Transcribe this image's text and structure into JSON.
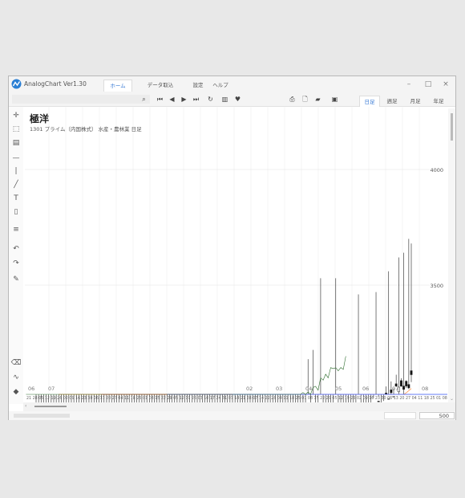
{
  "app": {
    "title": "AnalogChart Ver1.30"
  },
  "tabs": [
    {
      "label": "ホーム",
      "active": true
    },
    {
      "label": "データ取込",
      "active": false
    },
    {
      "label": "設定",
      "active": false
    },
    {
      "label": "ヘルプ",
      "active": false
    }
  ],
  "periods": [
    {
      "label": "日足",
      "active": true
    },
    {
      "label": "週足",
      "active": false
    },
    {
      "label": "月足",
      "active": false
    },
    {
      "label": "年足",
      "active": false
    }
  ],
  "stock": {
    "name": "極洋",
    "info": "1301 プライム（内国株式） 水産・農林業 日足"
  },
  "zoom": {
    "value": "500"
  },
  "chart_data": {
    "type": "candlestick",
    "y_ticks": [
      "4000",
      "3500"
    ],
    "month_labels": [
      "06",
      "07",
      "02",
      "03",
      "04",
      "05",
      "06",
      "07",
      "08"
    ],
    "date_ticks": "21 28 05 12 19 26 02 09 16 23 30 06 13 20 27 04 11 18 25 01 08 15 22 29 05 12 19 26 03 10 17 24 31 07 14 21 28 07 14 22 28 04 11 18 25 01 08 15 22 29 05 12 19 26 02 09 16 23 30 06 13 20 27 04 11 18 25 01 08 15 22 29",
    "line_colors": {
      "kijun": "#e83030",
      "tenkan": "#ff8a3c",
      "spanA": "#4040d0",
      "spanB": "#6080ff",
      "chikou": "#2a6a2a"
    },
    "candle_colors": {
      "up": "#ffffff",
      "down": "#111111"
    }
  },
  "icons": {
    "toolbar": [
      "search-icon",
      "first-icon",
      "prev-icon",
      "next-icon",
      "last-icon",
      "refresh-icon",
      "bars-icon",
      "heart-icon",
      "print-icon",
      "new-file-icon",
      "folder-icon",
      "save-icon"
    ],
    "left": [
      "crosshair-icon",
      "rect-select-icon",
      "text-box-icon",
      "hline-icon",
      "vline-icon",
      "trendline-icon",
      "text-icon",
      "note-icon",
      "fibonacci-icon",
      "undo-icon",
      "redo-icon",
      "wrench-icon",
      "delete-icon",
      "line-tool-icon",
      "paint-icon"
    ]
  }
}
